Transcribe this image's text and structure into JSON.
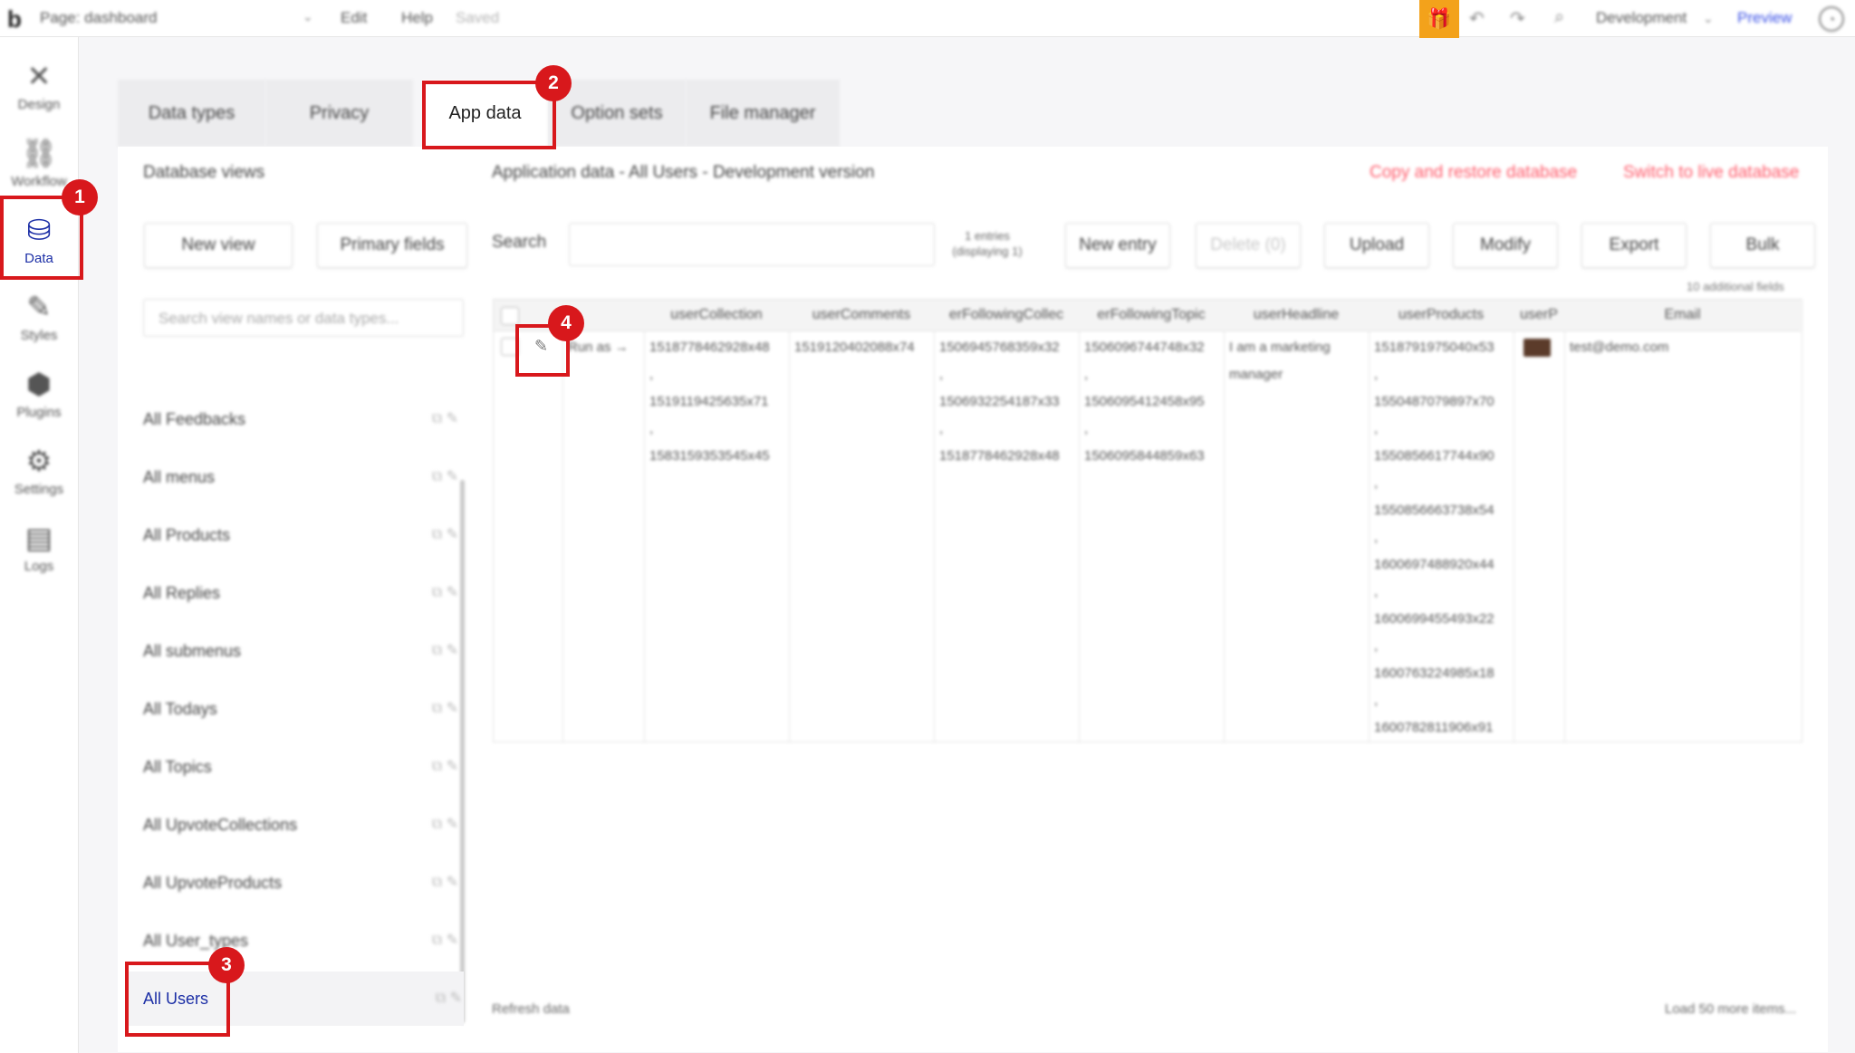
{
  "topbar": {
    "logo": "b",
    "page_label": "Page: dashboard",
    "menu_edit": "Edit",
    "menu_help": "Help",
    "saved_status": "Saved",
    "gift_icon": "gift-icon",
    "environment": "Development",
    "preview": "Preview"
  },
  "rail": [
    {
      "label": "Design",
      "icon": "✕"
    },
    {
      "label": "Workflow",
      "icon": "⛓"
    },
    {
      "label": "Data",
      "icon": "⛁"
    },
    {
      "label": "Styles",
      "icon": "✎"
    },
    {
      "label": "Plugins",
      "icon": "⬢"
    },
    {
      "label": "Settings",
      "icon": "⚙"
    },
    {
      "label": "Logs",
      "icon": "▤"
    }
  ],
  "tabs": [
    "Data types",
    "Privacy",
    "App data",
    "Option sets",
    "File manager"
  ],
  "views": {
    "title": "Database views",
    "new_view": "New view",
    "primary_fields": "Primary fields",
    "search_placeholder": "Search view names or data types...",
    "items": [
      "All Feedbacks",
      "All menus",
      "All Products",
      "All Replies",
      "All submenus",
      "All Todays",
      "All Topics",
      "All UpvoteCollections",
      "All UpvoteProducts",
      "All User_types",
      "All Users"
    ]
  },
  "appdata": {
    "title": "Application data - All Users - Development version",
    "copy_restore": "Copy and restore database",
    "switch_live": "Switch to live database",
    "search_label": "Search",
    "entries": "1 entries",
    "displaying": "(displaying 1)",
    "new_entry": "New entry",
    "delete": "Delete (0)",
    "upload": "Upload",
    "modify": "Modify",
    "export": "Export",
    "bulk": "Bulk",
    "additional_fields": "10 additional fields",
    "refresh": "Refresh data",
    "load_more": "Load 50 more items..."
  },
  "table": {
    "run_as": "Run as →",
    "headers": [
      "userCollection",
      "userComments",
      "erFollowingCollec",
      "erFollowingTopic",
      "userHeadline",
      "userProducts",
      "userP",
      "Email"
    ],
    "userCollection": [
      "1518778462928x48",
      ",",
      "1519119425635x71",
      ",",
      "1583159353545x45"
    ],
    "userComments": [
      "1519120402088x74"
    ],
    "followingCollec": [
      "1506945768359x32",
      ",",
      "1506932254187x33",
      ",",
      "1518778462928x48"
    ],
    "followingTopic": [
      "1506096744748x32",
      ",",
      "1506095412458x95",
      ",",
      "1506095844859x63"
    ],
    "headline": [
      "I am a marketing",
      "manager"
    ],
    "products": [
      "1518791975040x53",
      ",",
      "1550487079897x70",
      ",",
      "1550856617744x90",
      ",",
      "1550856663738x54",
      ",",
      "1600697488920x44",
      ",",
      "1600699455493x22",
      ",",
      "1600763224985x18",
      ",",
      "1600782811906x91"
    ],
    "email": "test@demo.com"
  },
  "markers": [
    "1",
    "2",
    "3",
    "4"
  ]
}
